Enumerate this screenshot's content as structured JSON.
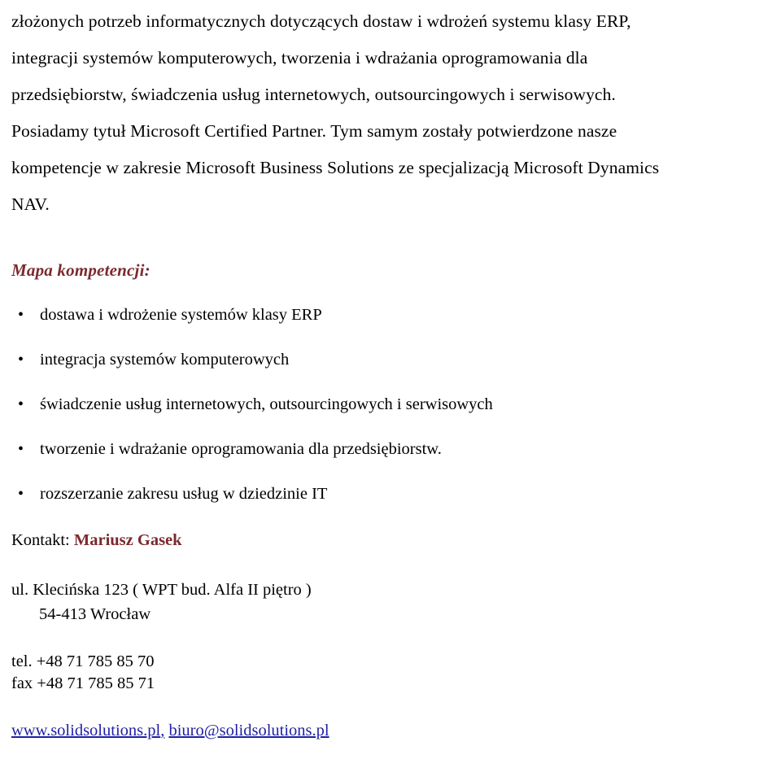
{
  "document": {
    "language": "pl",
    "accent_color": "#7a2a2e",
    "link_color": "#1f1fa5",
    "body_color": "#000000",
    "background_color": "#ffffff"
  },
  "intro": {
    "line1": "złożonych potrzeb informatycznych dotyczących dostaw i wdrożeń systemu klasy ERP,",
    "line2": "integracji systemów komputerowych, tworzenia i wdrażania oprogramowania dla",
    "line3": "przedsiębiorstw, świadczenia usług internetowych, outsourcingowych i serwisowych.",
    "line4": "Posiadamy tytuł Microsoft Certified Partner. Tym samym zostały potwierdzone nasze",
    "line5": "kompetencje w zakresie Microsoft Business Solutions ze specjalizacją Microsoft Dynamics",
    "line6": "NAV.",
    "full_text": "złożonych potrzeb informatycznych dotyczących dostaw i wdrożeń systemu klasy ERP, integracji systemów komputerowych, tworzenia i wdrażania oprogramowania dla przedsiębiorstw, świadczenia usług internetowych, outsourcingowych i serwisowych. Posiadamy tytuł Microsoft Certified Partner. Tym samym zostały potwierdzone nasze kompetencje w zakresie Microsoft Business Solutions ze specjalizacją Microsoft Dynamics NAV."
  },
  "competency_section": {
    "heading": "Mapa kompetencji:",
    "bullet_glyph": "•",
    "items": [
      {
        "text": "dostawa i wdrożenie systemów klasy ERP"
      },
      {
        "text": "integracja systemów komputerowych"
      },
      {
        "text": "świadczenie usług internetowych, outsourcingowych i serwisowych"
      },
      {
        "text": "tworzenie i wdrażanie oprogramowania dla przedsiębiorstw."
      },
      {
        "text": "rozszerzanie zakresu usług w dziedzinie IT"
      }
    ]
  },
  "contact": {
    "label": "Kontakt:",
    "name": "Mariusz Gasek",
    "address": {
      "street": "ul. Klecińska 123 ( WPT bud. Alfa II piętro )",
      "city": "54-413 Wrocław"
    },
    "phone": "tel. +48 71 785 85 70",
    "fax": "fax +48 71 785 85 71",
    "website": "www.solidsolutions.pl",
    "separator": ",",
    "email": "biuro@solidsolutions.pl"
  }
}
